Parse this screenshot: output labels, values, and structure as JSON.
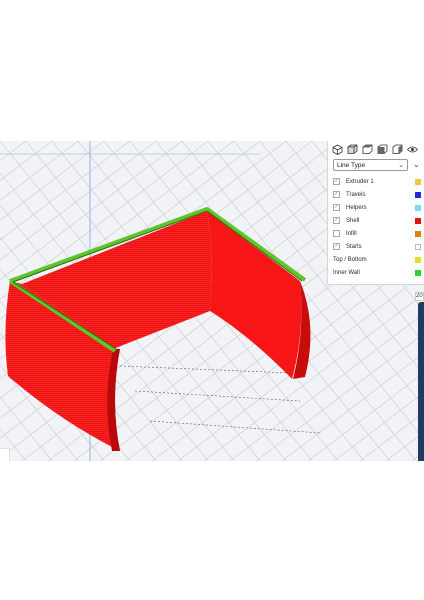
{
  "app": {
    "accent": "#1f3b63"
  },
  "view_buttons": [
    {
      "icon": "3d-view-icon"
    },
    {
      "icon": "front-view-icon"
    },
    {
      "icon": "top-view-icon"
    },
    {
      "icon": "left-view-icon"
    },
    {
      "icon": "right-view-icon"
    },
    {
      "icon": "visibility-icon"
    }
  ],
  "panel": {
    "view_type": {
      "selected": "Line Type",
      "options_visible": [
        "Line Type"
      ]
    },
    "collapse_icon": "chevron-down-icon",
    "items": [
      {
        "label": "Extruder 1",
        "checked": true,
        "color": "#f6c54a"
      },
      {
        "label": "Travels",
        "checked": true,
        "color": "#1f2bd6"
      },
      {
        "label": "Helpers",
        "checked": true,
        "color": "#6ee0f0"
      },
      {
        "label": "Shell",
        "checked": true,
        "color": "#e01010"
      },
      {
        "label": "Infill",
        "checked": false,
        "color": "#e07f1a"
      },
      {
        "label": "Starts",
        "checked": true,
        "color": "#ffffff"
      }
    ],
    "legend": [
      {
        "label": "Top / Bottom",
        "color": "#e3de2a"
      },
      {
        "label": "Inner Wall",
        "color": "#2ad62a"
      }
    ]
  },
  "layer_slider": {
    "value_label": "20"
  },
  "model": {
    "shell_color": "#ff1a1a",
    "top_color": "#5ec62a"
  }
}
